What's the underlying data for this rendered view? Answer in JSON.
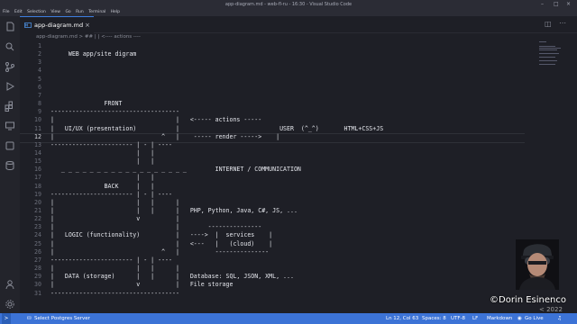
{
  "window": {
    "title": "app-diagram.md - web-fl-ru - 16:30 - Visual Studio Code"
  },
  "menu": [
    "File",
    "Edit",
    "Selection",
    "View",
    "Go",
    "Run",
    "Terminal",
    "Help"
  ],
  "tab": {
    "label": "app-diagram.md"
  },
  "breadcrumb": "app-diagram.md > ## |                  | <---- actions ----",
  "editor": {
    "lines": [
      {
        "n": "1",
        "text": ""
      },
      {
        "n": "2",
        "text": "     WEB app/site digram"
      },
      {
        "n": "3",
        "text": ""
      },
      {
        "n": "4",
        "text": ""
      },
      {
        "n": "5",
        "text": ""
      },
      {
        "n": "6",
        "text": ""
      },
      {
        "n": "7",
        "text": ""
      },
      {
        "n": "8",
        "text": "               FRONT"
      },
      {
        "n": "9",
        "text": "------------------------------------"
      },
      {
        "n": "10",
        "text": "|                                  |   <----- actions -----"
      },
      {
        "n": "11",
        "text": "|   UI/UX (presentation)           |                            USER  (^_^)       HTML+CSS+JS"
      },
      {
        "n": "12",
        "text": "|                              ^   |    ----- render ----->    |"
      },
      {
        "n": "13",
        "text": "----------------------- | - | ----"
      },
      {
        "n": "14",
        "text": "                        |   |"
      },
      {
        "n": "15",
        "text": "                        |   |"
      },
      {
        "n": "16",
        "text": "   _ _ _ _ _ _ _ _ _ _ _ _ _ _ _ _ _ _        INTERNET / COMMUNICATION"
      },
      {
        "n": "17",
        "text": "                        |   |"
      },
      {
        "n": "18",
        "text": "               BACK     |   |"
      },
      {
        "n": "19",
        "text": "----------------------- | - | ----"
      },
      {
        "n": "20",
        "text": "|                       |   |      |"
      },
      {
        "n": "21",
        "text": "|                       |   |      |   PHP, Python, Java, C#, JS, ..."
      },
      {
        "n": "22",
        "text": "|                       v          |"
      },
      {
        "n": "23",
        "text": "|                                  |        ---------------"
      },
      {
        "n": "24",
        "text": "|   LOGIC (functionality)          |   ---->  |  services    |"
      },
      {
        "n": "25",
        "text": "|                                  |   <---   |   (cloud)    |"
      },
      {
        "n": "26",
        "text": "|                              ^   |          ---------------"
      },
      {
        "n": "27",
        "text": "----------------------- | - | ----"
      },
      {
        "n": "28",
        "text": "|                       |   |      |"
      },
      {
        "n": "29",
        "text": "|   DATA (storage)      |   |      |   Database: SQL, JSON, XML, ..."
      },
      {
        "n": "30",
        "text": "|                       v          |   File storage"
      },
      {
        "n": "31",
        "text": "------------------------------------"
      }
    ]
  },
  "status": {
    "db": "Select Postgres Server",
    "position": "Ln 12, Col 63",
    "spaces": "Spaces: 8",
    "encoding": "UTF-8",
    "eol": "LF",
    "language": "Markdown",
    "golive": "Go Live"
  },
  "watermark": {
    "name": "©Dorin Esinenco",
    "year": "2022"
  },
  "colors": {
    "accent": "#3c73d6",
    "background": "#1e1f26"
  }
}
